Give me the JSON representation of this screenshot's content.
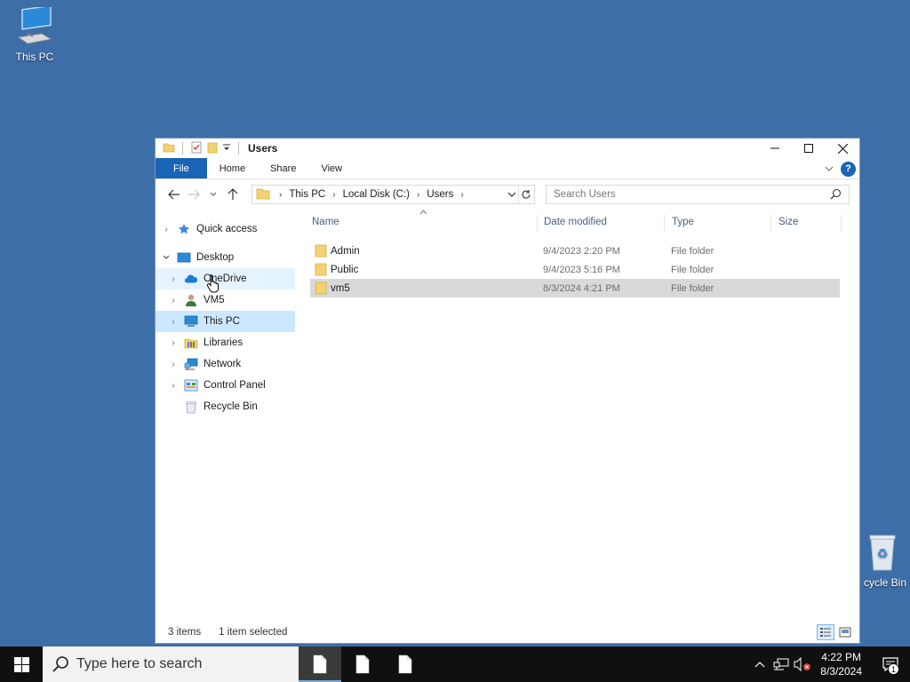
{
  "desktop": {
    "icons": [
      {
        "label": "This PC",
        "icon": "computer-icon"
      },
      {
        "label": "cycle Bin",
        "icon": "recycle-bin-icon"
      }
    ]
  },
  "window": {
    "title": "Users",
    "ribbon_tabs": [
      "File",
      "Home",
      "Share",
      "View"
    ],
    "address": {
      "breadcrumbs": [
        "This PC",
        "Local Disk (C:)",
        "Users"
      ]
    },
    "search": {
      "placeholder": "Search Users"
    },
    "nav_pane": [
      {
        "label": "Quick access",
        "icon": "star-icon",
        "expand": "collapsed",
        "indent": 0
      },
      {
        "label": "Desktop",
        "icon": "desktop-icon",
        "expand": "expanded",
        "indent": 0
      },
      {
        "label": "OneDrive",
        "icon": "cloud-icon",
        "expand": "collapsed",
        "indent": 1
      },
      {
        "label": "VM5",
        "icon": "user-icon",
        "expand": "collapsed",
        "indent": 1
      },
      {
        "label": "This PC",
        "icon": "computer-icon",
        "expand": "collapsed",
        "indent": 1
      },
      {
        "label": "Libraries",
        "icon": "library-icon",
        "expand": "collapsed",
        "indent": 1
      },
      {
        "label": "Network",
        "icon": "network-icon",
        "expand": "collapsed",
        "indent": 1
      },
      {
        "label": "Control Panel",
        "icon": "control-panel-icon",
        "expand": "collapsed",
        "indent": 1
      },
      {
        "label": "Recycle Bin",
        "icon": "recycle-bin-icon",
        "expand": "none",
        "indent": 1
      }
    ],
    "columns": [
      "Name",
      "Date modified",
      "Type",
      "Size"
    ],
    "files": [
      {
        "name": "Admin",
        "date": "9/4/2023 2:20 PM",
        "type": "File folder",
        "size": ""
      },
      {
        "name": "Public",
        "date": "9/4/2023 5:16 PM",
        "type": "File folder",
        "size": ""
      },
      {
        "name": "vm5",
        "date": "8/3/2024 4:21 PM",
        "type": "File folder",
        "size": ""
      }
    ],
    "status": {
      "items": "3 items",
      "selected": "1 item selected"
    }
  },
  "taskbar": {
    "search_placeholder": "Type here to search",
    "time": "4:22 PM",
    "date": "8/3/2024",
    "notification_count": "1"
  },
  "colors": {
    "desktop": "#3e6ea7",
    "accent": "#1a64b5",
    "selection": "#cce8ff",
    "row_selected": "#d9d9d9",
    "taskbar": "#101010"
  }
}
